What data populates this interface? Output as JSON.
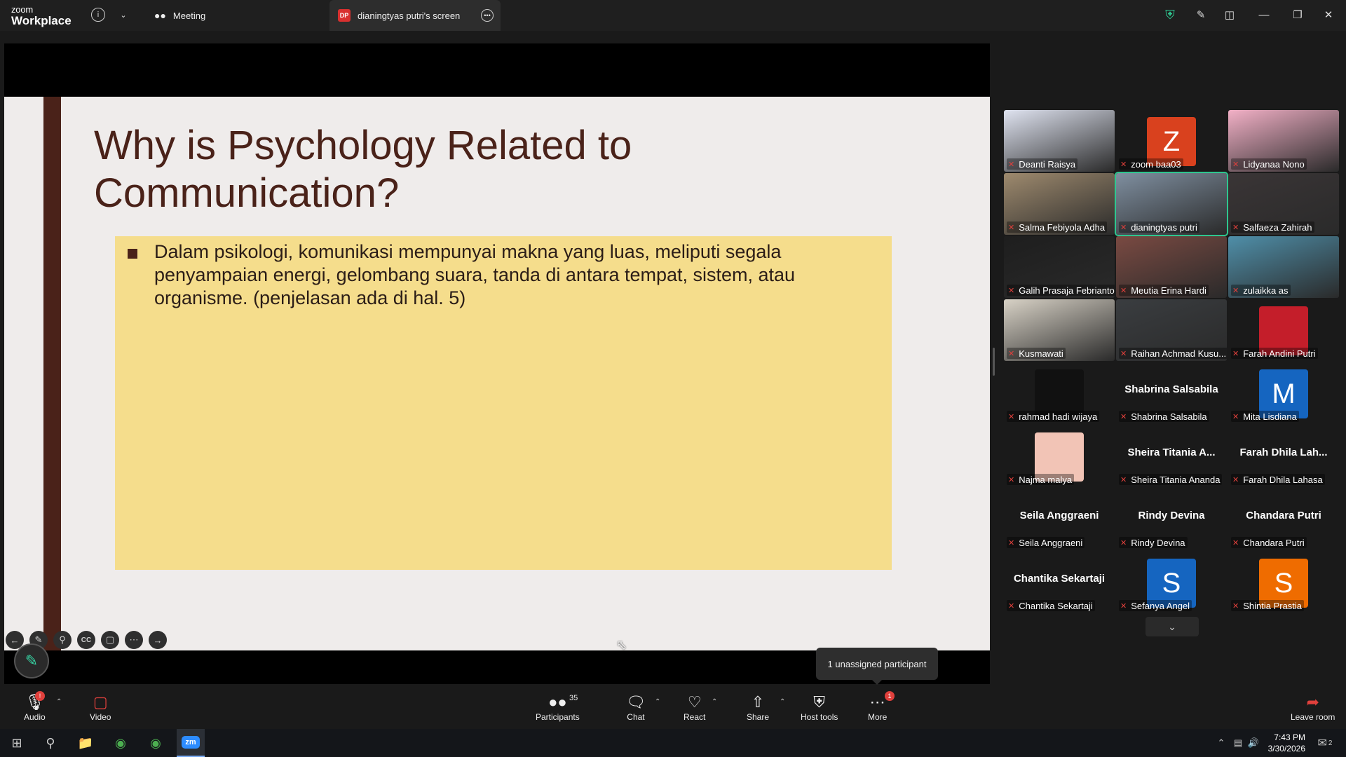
{
  "app": {
    "brand_line1": "zoom",
    "brand_line2": "Workplace"
  },
  "tabs": [
    {
      "label": "Meeting",
      "icon": "people-icon"
    },
    {
      "label": "dianingtyas putri's screen",
      "badge": "DP",
      "icon": "more-icon"
    }
  ],
  "slide": {
    "title": "Why is Psychology Related to Communication?",
    "bullet": "Dalam psikologi, komunikasi mempunyai makna yang luas, meliputi segala penyampaian energi, gelombang suara, tanda di antara tempat, sistem, atau organisme. (penjelasan ada di hal. 5)"
  },
  "tooltip": "1 unassigned participant",
  "participants": [
    {
      "name": "Deanti Raisya",
      "kind": "video",
      "bg": "#dfe3f0"
    },
    {
      "name": "zoom baa03",
      "kind": "avatar",
      "letter": "Z",
      "color": "#d9411e"
    },
    {
      "name": "Lidyanaa Nono",
      "kind": "video",
      "bg": "#f2b0c6"
    },
    {
      "name": "Salma Febiyola Adha",
      "kind": "video",
      "bg": "#9e8a6e"
    },
    {
      "name": "dianingtyas putri",
      "kind": "video",
      "bg": "#7f8fa0",
      "speaking": true
    },
    {
      "name": "Salfaeza Zahirah",
      "kind": "video",
      "bg": "#3a3536"
    },
    {
      "name": "Galih Prasaja Febrianto",
      "kind": "video",
      "bg": "#1e1e1e"
    },
    {
      "name": "Meutia Erina Hardi",
      "kind": "video",
      "bg": "#7a4a42"
    },
    {
      "name": "zulaikka as",
      "kind": "video",
      "bg": "#4f8fa9"
    },
    {
      "name": "Kusmawati",
      "kind": "video",
      "bg": "#d8d2c6"
    },
    {
      "name": "Raihan Achmad Kusu...",
      "kind": "video",
      "bg": "#3a3d40"
    },
    {
      "name": "Farah Andini Putri",
      "kind": "avatar",
      "letter": "",
      "color": "#c41e2a"
    },
    {
      "name": "rahmad hadi wijaya",
      "kind": "avatar",
      "letter": "",
      "color": "#111111"
    },
    {
      "name": "Shabrina Salsabila",
      "kind": "text",
      "display": "Shabrina Salsabila"
    },
    {
      "name": "Mita Lisdiana",
      "kind": "avatar",
      "letter": "M",
      "color": "#1565c0"
    },
    {
      "name": "Najma malya",
      "kind": "avatar",
      "letter": "",
      "color": "#f2c4b6"
    },
    {
      "name": "Sheira Titania Ananda",
      "kind": "text",
      "display": "Sheira Titania A..."
    },
    {
      "name": "Farah Dhila Lahasa",
      "kind": "text",
      "display": "Farah Dhila Lah..."
    },
    {
      "name": "Seila Anggraeni",
      "kind": "text",
      "display": "Seila Anggraeni"
    },
    {
      "name": "Rindy Devina",
      "kind": "text",
      "display": "Rindy Devina"
    },
    {
      "name": "Chandara Putri",
      "kind": "text",
      "display": "Chandara Putri"
    },
    {
      "name": "Chantika Sekartaji",
      "kind": "text",
      "display": "Chantika Sekartaji"
    },
    {
      "name": "Sefanya Angel",
      "kind": "avatar",
      "letter": "S",
      "color": "#1565c0"
    },
    {
      "name": "Shintia Prastia",
      "kind": "avatar",
      "letter": "S",
      "color": "#ef6c00"
    }
  ],
  "toolbar": {
    "audio": "Audio",
    "video": "Video",
    "participants": "Participants",
    "participants_count": "35",
    "chat": "Chat",
    "react": "React",
    "share": "Share",
    "host_tools": "Host tools",
    "more": "More",
    "more_badge": "1",
    "leave": "Leave room"
  },
  "taskbar": {
    "time": "7:43 PM",
    "date": "3/30/2026",
    "notif_count": "2"
  },
  "colors": {
    "accent": "#2ec68f",
    "danger": "#e0403c",
    "slide_brown": "#4a2219",
    "slide_yellow": "#f5dd8c"
  }
}
